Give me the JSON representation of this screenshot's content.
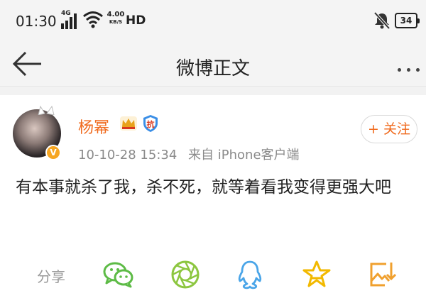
{
  "status_bar": {
    "time": "01:30",
    "network": "4G",
    "speed_value": "4.00",
    "speed_unit": "KB/S",
    "hd": "HD",
    "battery": "34"
  },
  "nav": {
    "title": "微博正文",
    "back_icon": "arrow-left-icon",
    "more_icon": "more-dots-icon"
  },
  "post": {
    "username": "杨幂",
    "username_color": "#f06a1d",
    "badges": [
      "crown-icon",
      "shield-badge-icon"
    ],
    "shield_text": "抗",
    "verified_mark": "V",
    "date": "10-10-28 15:34",
    "source": "来自 iPhone客户端",
    "follow_label": "+ 关注",
    "text": "有本事就杀了我，杀不死，就等着看我变得更强大吧"
  },
  "share": {
    "label": "分享",
    "icons": [
      "wechat-icon",
      "moments-icon",
      "qq-icon",
      "qzone-star-icon",
      "save-image-icon"
    ]
  }
}
